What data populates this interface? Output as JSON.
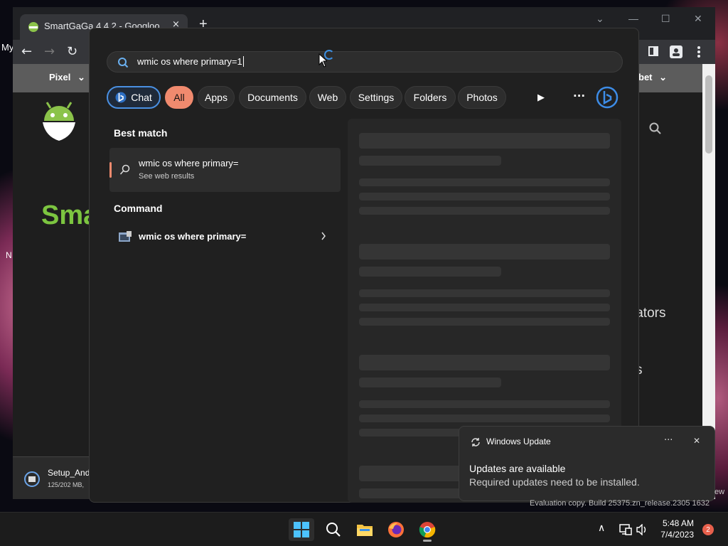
{
  "desktop": {
    "stray_top": "My",
    "stray_mid": "N",
    "stray_marks": [
      "l",
      "l",
      "l"
    ],
    "watermark": "Evaluation copy. Build 25375.zn_release.2305 1632",
    "right_edge_text": "ew"
  },
  "browser": {
    "tab_title": "SmartGaGa 4.4.2 - Googloo",
    "tab_close": "×",
    "new_tab": "+",
    "window_controls": {
      "dropdown": "⌄",
      "minimize": "—",
      "maximize": "☐",
      "close": "✕"
    },
    "toolbar": {
      "back": "←",
      "forward": "→",
      "reload": "↻"
    },
    "bookmarks": [
      {
        "label": "Pixel"
      },
      {
        "label": "bet"
      }
    ],
    "page": {
      "brand_partial": "Sma",
      "text_right1": "lators",
      "text_right2": "s"
    },
    "download": {
      "filename": "Setup_And",
      "progress": "125/202 MB,"
    }
  },
  "search": {
    "query": "wmic os where primary=1",
    "chips": [
      {
        "label": "Chat",
        "kind": "chat"
      },
      {
        "label": "All",
        "kind": "active"
      },
      {
        "label": "Apps"
      },
      {
        "label": "Documents"
      },
      {
        "label": "Web"
      },
      {
        "label": "Settings"
      },
      {
        "label": "Folders"
      },
      {
        "label": "Photos"
      }
    ],
    "more_play": "▶",
    "more_dots": "···",
    "best_match_heading": "Best match",
    "best_match": {
      "title": "wmic os where primary=",
      "subtitle": "See web results"
    },
    "command_heading": "Command",
    "command": {
      "title": "wmic os where primary="
    }
  },
  "toast": {
    "app": "Windows Update",
    "more": "···",
    "close": "✕",
    "heading": "Updates are available",
    "body": "Required updates need to be installed."
  },
  "taskbar": {
    "time": "5:48 AM",
    "date": "7/4/2023",
    "notifications": "2",
    "chevron": "∧"
  },
  "colors": {
    "accent": "#f08a6e",
    "chat_border": "#4a90e2",
    "panel_bg": "#202020"
  }
}
